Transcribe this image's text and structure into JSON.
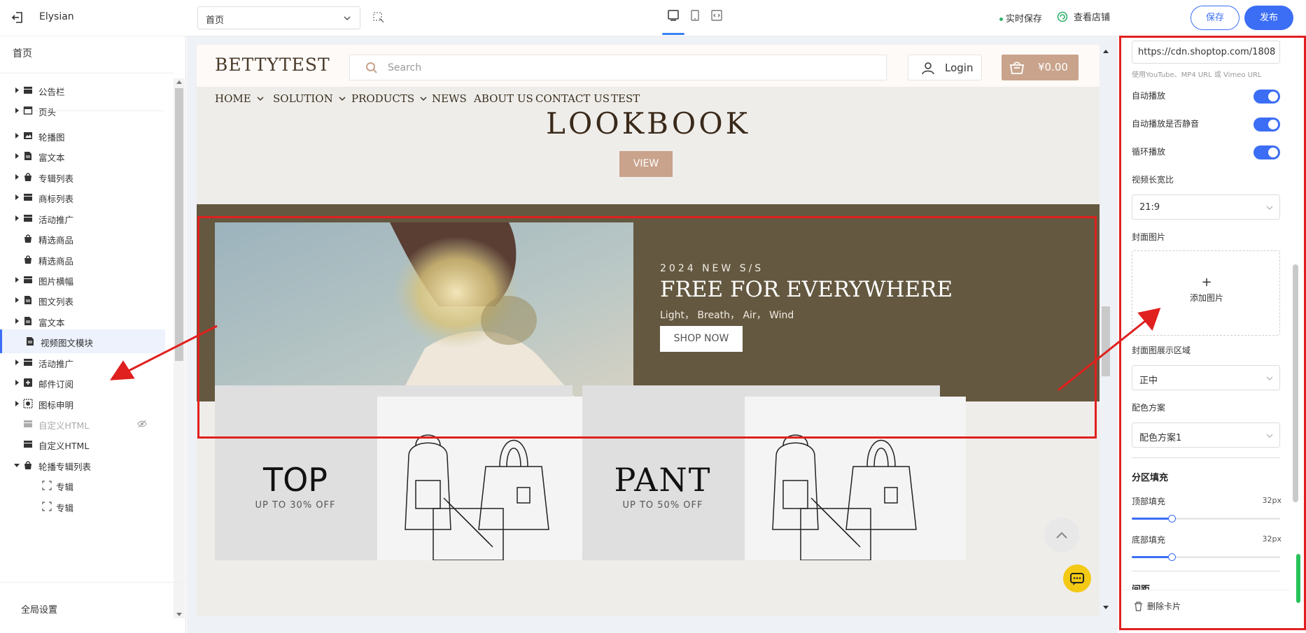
{
  "topbar": {
    "app_name": "Elysian",
    "page_select_value": "首页",
    "autosave_label": "实时保存",
    "view_store_label": "查看店铺",
    "save_label": "保存",
    "publish_label": "发布",
    "accent_color": "#3b6ef5"
  },
  "sidebar": {
    "home_label": "首页",
    "items": [
      {
        "label": "公告栏",
        "icon": "layers-icon",
        "caret": true
      },
      {
        "label": "页头",
        "icon": "window-icon",
        "caret": true
      },
      {
        "label": "轮播图",
        "icon": "image-icon",
        "caret": true
      },
      {
        "label": "富文本",
        "icon": "document-icon",
        "caret": true
      },
      {
        "label": "专辑列表",
        "icon": "bag-icon",
        "caret": true
      },
      {
        "label": "商标列表",
        "icon": "layers-icon",
        "caret": true
      },
      {
        "label": "活动推广",
        "icon": "layers-icon",
        "caret": true
      },
      {
        "label": "精选商品",
        "icon": "bag-icon",
        "caret": false
      },
      {
        "label": "精选商品",
        "icon": "bag-icon",
        "caret": false
      },
      {
        "label": "图片横幅",
        "icon": "layers-icon",
        "caret": true
      },
      {
        "label": "图文列表",
        "icon": "document-icon",
        "caret": true
      },
      {
        "label": "富文本",
        "icon": "document-icon",
        "caret": true
      },
      {
        "label": "视频图文模块",
        "icon": "document-icon",
        "caret": false,
        "selected": true
      },
      {
        "label": "活动推广",
        "icon": "layers-icon",
        "caret": true
      },
      {
        "label": "邮件订阅",
        "icon": "mail-plus-icon",
        "caret": true
      },
      {
        "label": "图标申明",
        "icon": "badge-icon",
        "caret": true
      },
      {
        "label": "自定义HTML",
        "icon": "layers-icon",
        "caret": false,
        "hidden": true
      },
      {
        "label": "自定义HTML",
        "icon": "layers-icon",
        "caret": false
      },
      {
        "label": "轮播专辑列表",
        "icon": "bag-icon",
        "caret": true,
        "expanded": true
      },
      {
        "label": "专辑",
        "icon": "frame-icon",
        "child": true
      },
      {
        "label": "专辑",
        "icon": "frame-icon",
        "child": true
      }
    ],
    "global_settings_label": "全局设置"
  },
  "preview": {
    "logo": "BETTYTEST",
    "search_placeholder": "Search",
    "login_label": "Login",
    "cart_total": "¥0.00",
    "nav": [
      "HOME",
      "SOLUTION",
      "PRODUCTS",
      "NEWS",
      "ABOUT US",
      "CONTACT US",
      "TEST"
    ],
    "lookbook_title": "LOOKBOOK",
    "view_button": "VIEW",
    "video_section": {
      "eyebrow": "2024 NEW S/S",
      "title": "FREE FOR EVERYWHERE",
      "subtitle": "Light， Breath， Air， Wind",
      "button": "SHOP NOW",
      "bg_color": "#645840"
    },
    "promos": [
      {
        "title": "TOP",
        "subtitle": "UP TO 30% OFF"
      },
      {
        "title": "PANT",
        "subtitle": "UP TO 50% OFF"
      }
    ]
  },
  "settings": {
    "video_url_value": "https://cdn.shoptop.com/1808",
    "video_url_hint": "使用YouTube、MP4 URL 或 Vimeo URL",
    "autoplay_label": "自动播放",
    "autoplay": true,
    "autoplay_muted_label": "自动播放是否静音",
    "autoplay_muted": true,
    "loop_label": "循环播放",
    "loop": true,
    "aspect_ratio_label": "视频长宽比",
    "aspect_ratio_value": "21:9",
    "cover_image_label": "封面图片",
    "add_image_label": "添加图片",
    "cover_area_label": "封面图展示区域",
    "cover_area_value": "正中",
    "color_scheme_label": "配色方案",
    "color_scheme_value": "配色方案1",
    "padding_section_label": "分区填充",
    "top_padding_label": "顶部填充",
    "top_padding_value": "32px",
    "top_padding_fraction": 0.27,
    "bottom_padding_label": "底部填充",
    "bottom_padding_value": "32px",
    "bottom_padding_fraction": 0.27,
    "spacing_label": "间距",
    "delete_card_label": "删除卡片"
  }
}
